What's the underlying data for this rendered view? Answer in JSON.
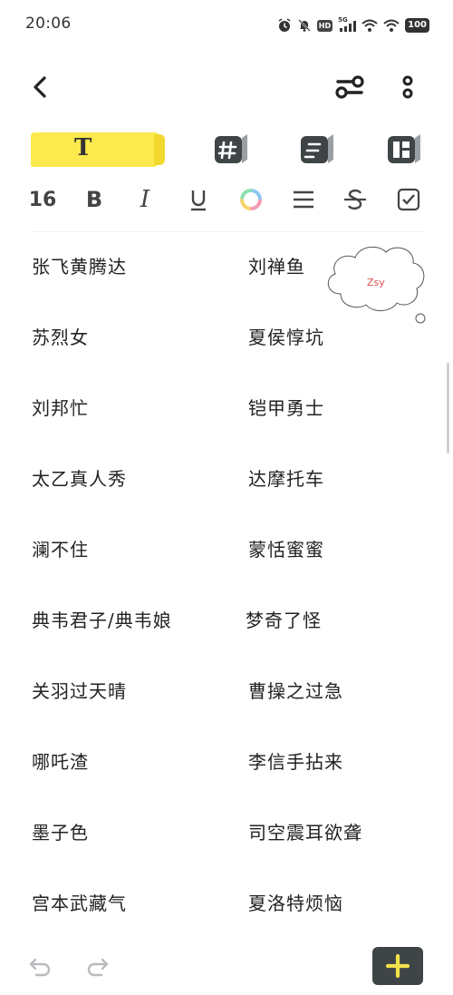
{
  "status_bar": {
    "time": "20:06",
    "hd_label": "HD",
    "network_label": "5G",
    "battery": "100"
  },
  "icons": {
    "back": "chevron-left-icon",
    "filter": "sliders-icon",
    "more": "more-vertical-icon",
    "undo": "undo-icon",
    "redo": "redo-icon",
    "add": "plus-icon"
  },
  "toolbar": {
    "text_mode_label": "T",
    "font_size": "16",
    "bold_label": "B",
    "italic_label": "I"
  },
  "colors": {
    "accent_yellow": "#fbe94d",
    "dark_button": "#3f4447",
    "plus_yellow": "#f3e24a"
  },
  "bubble": {
    "text": "Zsy"
  },
  "list": {
    "rows": [
      {
        "left": "张飞黄腾达",
        "right": "刘禅鱼"
      },
      {
        "left": "苏烈女",
        "right": "夏侯惇坑"
      },
      {
        "left": "刘邦忙",
        "right": "铠甲勇士"
      },
      {
        "left": "太乙真人秀",
        "right": "达摩托车"
      },
      {
        "left": "澜不住",
        "right": "蒙恬蜜蜜"
      },
      {
        "left": "典韦君子/典韦娘",
        "right": "梦奇了怪"
      },
      {
        "left": "关羽过天晴",
        "right": "曹操之过急"
      },
      {
        "left": "哪吒渣",
        "right": "李信手拈来"
      },
      {
        "left": "墨子色",
        "right": "司空震耳欲聋"
      },
      {
        "left": "宫本武藏气",
        "right": "夏洛特烦恼"
      }
    ]
  }
}
